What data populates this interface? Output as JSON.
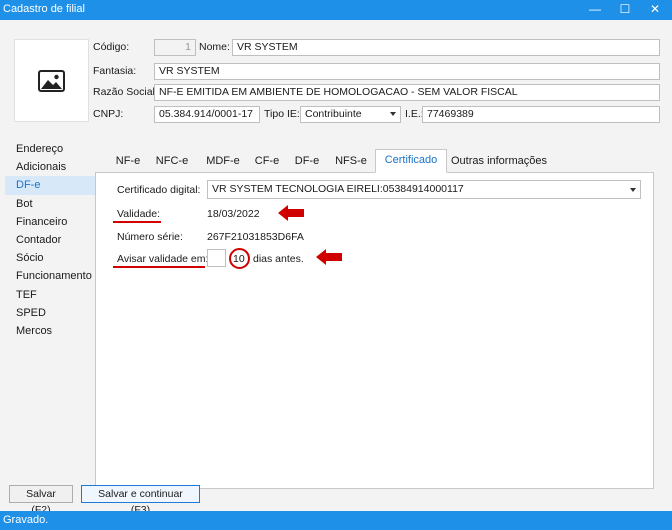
{
  "window": {
    "title": "Cadastro de filial",
    "min": "—",
    "max": "☐",
    "close": "✕"
  },
  "header": {
    "codigo_label": "Código:",
    "codigo_value": "1",
    "nome_label": "Nome:",
    "nome_value": "VR SYSTEM",
    "fantasia_label": "Fantasia:",
    "fantasia_value": "VR SYSTEM",
    "razao_label": "Razão Social:",
    "razao_value": "NF-E EMITIDA EM AMBIENTE DE HOMOLOGACAO - SEM VALOR FISCAL",
    "cnpj_label": "CNPJ:",
    "cnpj_value": "05.384.914/0001-17",
    "tipoie_label": "Tipo IE:",
    "tipoie_value": "Contribuinte",
    "ie_label": "I.E.:",
    "ie_value": "77469389"
  },
  "sidebar": {
    "items": [
      {
        "label": "Endereço"
      },
      {
        "label": "Adicionais"
      },
      {
        "label": "DF-e"
      },
      {
        "label": "Bot"
      },
      {
        "label": "Financeiro"
      },
      {
        "label": "Contador"
      },
      {
        "label": "Sócio"
      },
      {
        "label": "Funcionamento"
      },
      {
        "label": "TEF"
      },
      {
        "label": "SPED"
      },
      {
        "label": "Mercos"
      }
    ],
    "active": "DF-e"
  },
  "tabs": [
    {
      "label": "NF-e"
    },
    {
      "label": "NFC-e"
    },
    {
      "label": "MDF-e"
    },
    {
      "label": "CF-e"
    },
    {
      "label": "DF-e"
    },
    {
      "label": "NFS-e"
    },
    {
      "label": "Certificado"
    },
    {
      "label": "Outras informações"
    }
  ],
  "certificado": {
    "cert_label": "Certificado digital:",
    "cert_value": "VR SYSTEM TECNOLOGIA EIRELI:05384914000117",
    "validade_label": "Validade:",
    "validade_value": "18/03/2022",
    "numero_label": "Número série:",
    "numero_value": "267F21031853D6FA",
    "avisar_label": "Avisar validade em:",
    "avisar_value": "10",
    "avisar_suffix": "dias antes."
  },
  "buttons": {
    "salvar": "Salvar (F2)",
    "salvar_continuar": "Salvar e continuar (F3)"
  },
  "status": {
    "text": "Gravado."
  },
  "colors": {
    "accent": "#1e90e8",
    "highlight": "#d10000"
  }
}
